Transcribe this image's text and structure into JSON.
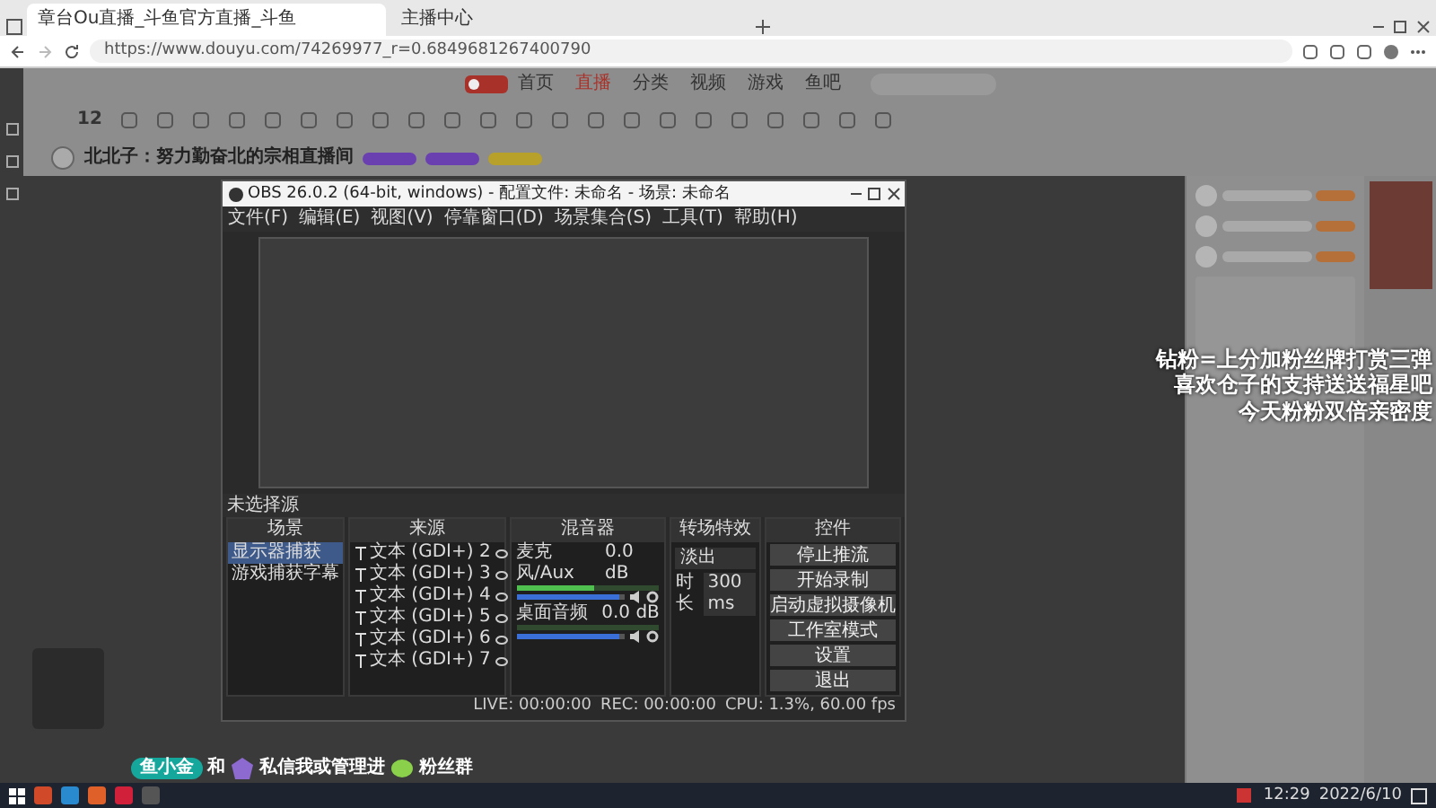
{
  "browser": {
    "tabs": [
      {
        "title": "章台Ou直播_斗鱼官方直播_斗鱼",
        "selected": true
      },
      {
        "title": "主播中心",
        "selected": false
      }
    ],
    "url": "https://www.douyu.com/74269977_r=0.6849681267400790"
  },
  "site": {
    "nav": [
      {
        "label": "首页",
        "selected": false
      },
      {
        "label": "直播",
        "selected": true
      },
      {
        "label": "分类",
        "selected": false
      },
      {
        "label": "视频",
        "selected": false
      },
      {
        "label": "游戏",
        "selected": false
      },
      {
        "label": "鱼吧",
        "selected": false
      }
    ],
    "follow_count": "12",
    "stream_title": "北北子：努力勤奋北的宗相直播间"
  },
  "obs": {
    "title": "OBS 26.0.2 (64-bit, windows) - 配置文件: 未命名 - 场景: 未命名",
    "menu": [
      "文件(F)",
      "编辑(E)",
      "视图(V)",
      "停靠窗口(D)",
      "场景集合(S)",
      "工具(T)",
      "帮助(H)"
    ],
    "source_bar": "未选择源",
    "scenes": {
      "title": "场景",
      "items": [
        {
          "label": "显示器捕获",
          "selected": true
        },
        {
          "label": "游戏捕获字幕",
          "selected": false
        }
      ]
    },
    "sources": {
      "title": "来源",
      "items": [
        "文本 (GDI+) 2",
        "文本 (GDI+) 3",
        "文本 (GDI+) 4",
        "文本 (GDI+) 5",
        "文本 (GDI+) 6",
        "文本 (GDI+) 7"
      ]
    },
    "mixer": {
      "title": "混音器",
      "channels": [
        {
          "name": "麦克风/Aux",
          "reading": "0.0 dB",
          "level": 0.55,
          "fader": {
            "level": 0.95
          }
        },
        {
          "name": "桌面音频",
          "reading": "0.0 dB",
          "level": 0,
          "fader": {
            "level": 0.95
          }
        }
      ]
    },
    "transitions": {
      "title": "转场特效",
      "type": "淡出",
      "duration_label": "时长",
      "duration": "300 ms"
    },
    "controls": {
      "title": "控件",
      "buttons": [
        "停止推流",
        "开始录制",
        "启动虚拟摄像机",
        "工作室模式",
        "设置",
        "退出"
      ]
    },
    "status": [
      "LIVE: 00:00:00",
      "REC: 00:00:00",
      "CPU: 1.3%, 60.00 fps"
    ]
  },
  "overlay_lines": [
    "钻粉=上分加粉丝牌打赏三弹",
    "喜欢仓子的支持送送福星吧",
    "今天粉粉双倍亲密度"
  ],
  "banner": {
    "badge": "鱼小金",
    "parts": [
      "和",
      "私信我或管理进",
      "粉丝群"
    ]
  },
  "taskbar": {
    "time": "12:29",
    "date": "2022/6/10"
  }
}
